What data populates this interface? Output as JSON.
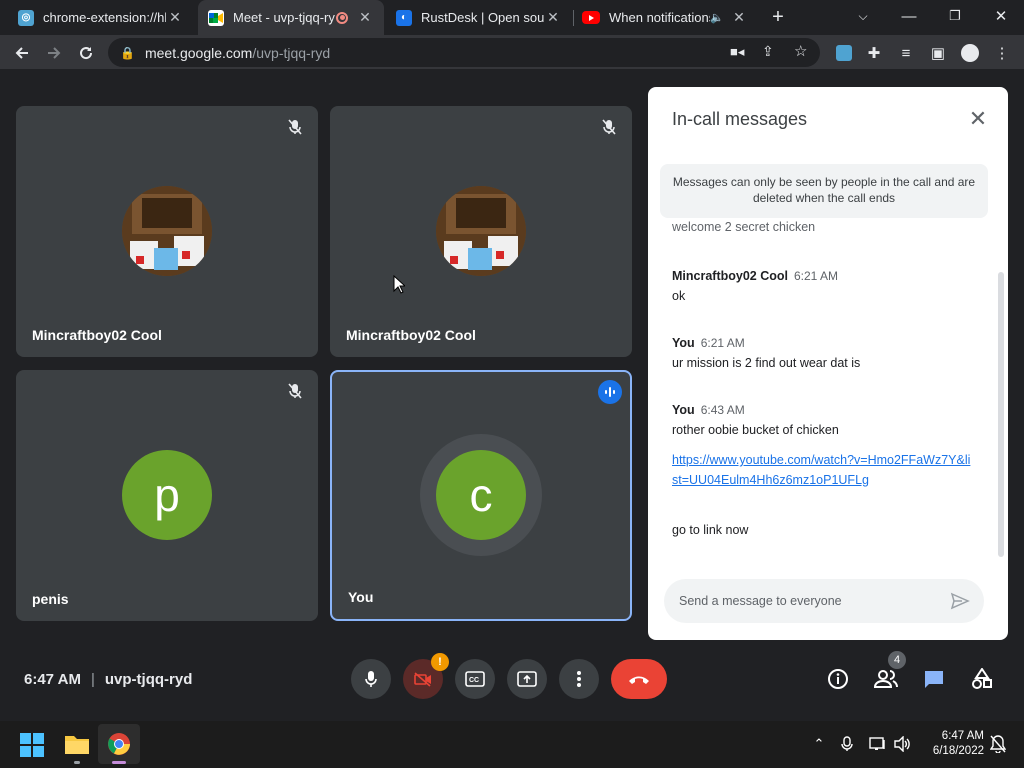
{
  "browser": {
    "tabs": [
      {
        "title": "chrome-extension://hh",
        "favicon": "extension-icon",
        "active": false
      },
      {
        "title": "Meet - uvp-tjqq-ry",
        "favicon": "google-meet-icon",
        "active": true
      },
      {
        "title": "RustDesk | Open sourc",
        "favicon": "rustdesk-icon",
        "active": false
      },
      {
        "title": "When notifications",
        "favicon": "youtube-icon",
        "active": false
      }
    ],
    "new_tab_label": "+",
    "url_host": "meet.google.com",
    "url_path": "/uvp-tjqq-ryd"
  },
  "meet": {
    "participants": [
      {
        "name": "Mincraftboy02 Cool",
        "muted": true,
        "avatar": "photo"
      },
      {
        "name": "Mincraftboy02 Cool",
        "muted": true,
        "avatar": "photo"
      },
      {
        "name": "penis",
        "muted": true,
        "avatar_letter": "p",
        "avatar_color": "#6aa32c"
      },
      {
        "name": "You",
        "speaking": true,
        "avatar_letter": "c",
        "avatar_color": "#6aa32c"
      }
    ],
    "time": "6:47 AM",
    "meeting_code": "uvp-tjqq-ryd",
    "people_count": "4",
    "camera_alert": "!"
  },
  "chat": {
    "title": "In-call messages",
    "notice": "Messages can only be seen by people in the call and are deleted when the call ends",
    "partial_message": "welcome 2 secret chicken",
    "messages": [
      {
        "sender": "Mincraftboy02 Cool",
        "time": "6:21 AM",
        "lines": [
          "ok"
        ]
      },
      {
        "sender": "You",
        "time": "6:21 AM",
        "lines": [
          "ur mission is 2 find out wear dat is"
        ]
      },
      {
        "sender": "You",
        "time": "6:43 AM",
        "lines": [
          "rother oobie bucket of chicken"
        ],
        "link": "https://www.youtube.com/watch?v=Hmo2FFaWz7Y&list=UU04Eulm4Hh6z6mz1oP1UFLg",
        "after": "go to link now"
      }
    ],
    "input_placeholder": "Send a message to everyone"
  },
  "taskbar": {
    "time": "6:47 AM",
    "date": "6/18/2022"
  },
  "colors": {
    "meet_bg": "#202124",
    "tile_bg": "#3c4043",
    "speaking_border": "#8ab4f8",
    "end_call": "#ea4335",
    "avatar_green": "#6aa32c",
    "link": "#1a73e8"
  }
}
